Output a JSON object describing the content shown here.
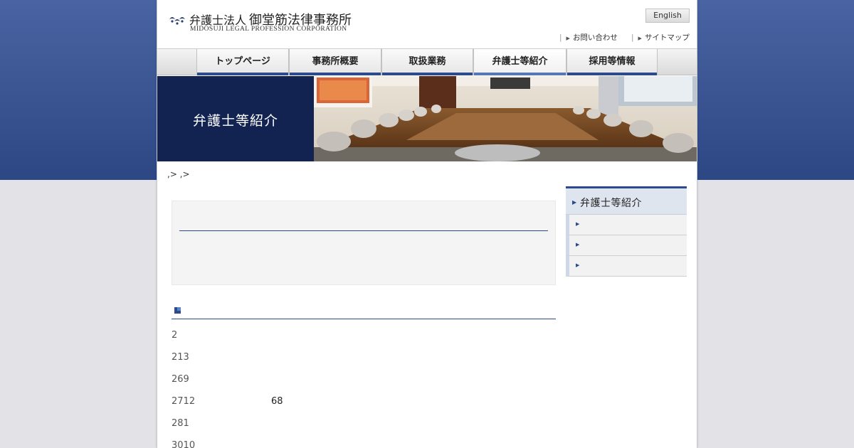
{
  "header": {
    "logo_title_prefix": "弁護士法人",
    "logo_title_main": "御堂筋法律事務所",
    "logo_subtitle": "MIDOSUJI LEGAL PROFESSION CORPORATION",
    "english_label": "English",
    "contact_label": "お問い合わせ",
    "sitemap_label": "サイトマップ"
  },
  "nav": {
    "items": [
      {
        "label": "トップページ"
      },
      {
        "label": "事務所概要"
      },
      {
        "label": "取扱業務"
      },
      {
        "label": "弁護士等紹介"
      },
      {
        "label": "採用等情報"
      }
    ],
    "active_label": "弁護士等紹介"
  },
  "hero": {
    "title": "弁護士等紹介"
  },
  "breadcrumb": ",> ,>",
  "history": [
    {
      "year": "2",
      "text": ""
    },
    {
      "year": "213",
      "text": ""
    },
    {
      "year": "269",
      "text": ""
    },
    {
      "year": "2712",
      "text": "68"
    },
    {
      "year": "281",
      "text": ""
    },
    {
      "year": "3010",
      "text": ""
    }
  ],
  "sidebar": {
    "heading": "弁護士等紹介",
    "items": [
      "",
      "",
      ""
    ]
  },
  "colors": {
    "navy": "#122352",
    "accent": "#2c4a8c",
    "background_top": "#4a64a3",
    "background_bottom": "#e3e3e7"
  }
}
